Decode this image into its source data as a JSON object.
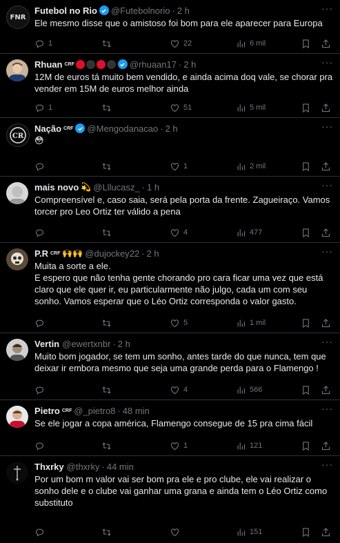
{
  "tweets": [
    {
      "name": "Futebol no Rio",
      "handle": "@Futebolnorio",
      "time": "2 h",
      "text": "Ele mesmo disse que o amistoso foi bom para ele aparecer para Europa",
      "replies": "1",
      "retweets": "",
      "likes": "22",
      "views": "6 mil",
      "avatar_text": "FNR"
    },
    {
      "name": "Rhuan",
      "handle": "@rhuaan17",
      "time": "2 h",
      "text": "12M de euros tá muito bem vendido, e ainda acima doq vale, se chorar pra vender em 15M de euros melhor ainda",
      "replies": "1",
      "retweets": "",
      "likes": "51",
      "views": "5 mil"
    },
    {
      "name": "Nação",
      "handle": "@Mengodanacao",
      "time": "2 h",
      "text": "😳",
      "replies": "",
      "retweets": "",
      "likes": "1",
      "views": "2 mil"
    },
    {
      "name": "mais novo",
      "handle": "@Lllucasz_",
      "time": "1 h",
      "text": "Compreensível e, caso saia, será pela porta da frente. Zagueiraço. Vamos torcer pro Leo Ortiz ter válido a pena",
      "replies": "",
      "retweets": "",
      "likes": "4",
      "views": "477"
    },
    {
      "name": "P.R",
      "handle": "@dujockey22",
      "time": "2 h",
      "text": "Muita a sorte a ele.\nE espero que não tenha gente chorando pro cara ficar uma vez que está claro que ele quer ir, eu particularmente não julgo, cada um com seu sonho. Vamos esperar que o Léo Ortiz corresponda o valor gasto.",
      "replies": "",
      "retweets": "",
      "likes": "5",
      "views": "1 mil"
    },
    {
      "name": "Vertin",
      "handle": "@ewertxnbr",
      "time": "2 h",
      "text": "Muito bom jogador, se tem um sonho, antes tarde do que nunca, tem que deixar ir embora mesmo que seja uma grande perda para o Flamengo !",
      "replies": "",
      "retweets": "",
      "likes": "4",
      "views": "566"
    },
    {
      "name": "Pietro",
      "handle": "@_pietro8",
      "time": "48 min",
      "text": "Se ele jogar a copa américa, Flamengo consegue de 15 pra cima fácil",
      "replies": "",
      "retweets": "",
      "likes": "1",
      "views": "121"
    },
    {
      "name": "Thxrky",
      "handle": "@thxrky",
      "time": "44 min",
      "text": "Por um bom m valor vai ser bom pra ele e pro clube, ele vai realizar o sonho dele e o clube vai ganhar uma grana e ainda tem o Léo Ortiz como substituto",
      "replies": "",
      "retweets": "",
      "likes": "",
      "views": "151"
    }
  ],
  "badges": {
    "crf": "CRF",
    "emoji_mais_novo": "💫",
    "emoji_pr": "🙌🙌"
  },
  "colors": {
    "background": "#000000",
    "text": "#e7e9ea",
    "muted": "#71767b",
    "verified": "#1d9bf0",
    "red": "#e0102a"
  }
}
